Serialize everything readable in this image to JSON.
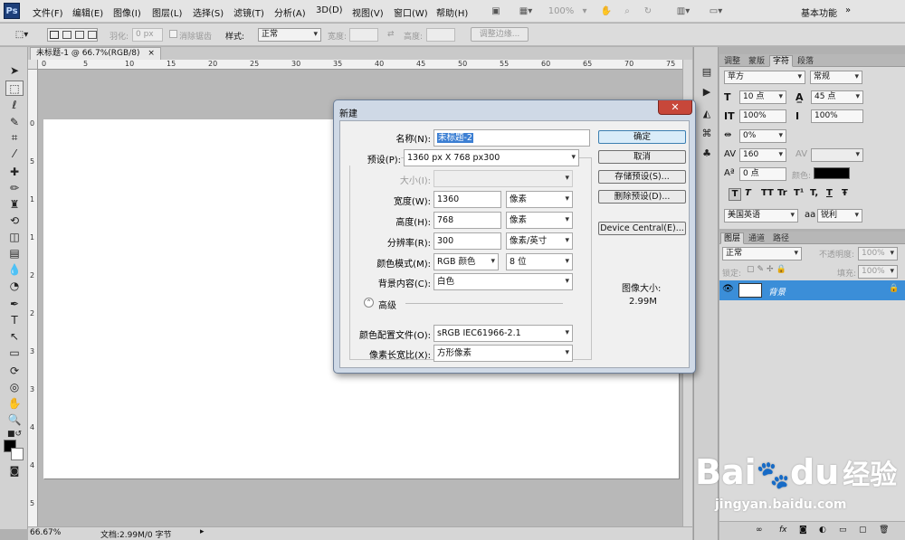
{
  "app": {
    "logo": "Ps"
  },
  "menu": [
    "文件(F)",
    "编辑(E)",
    "图像(I)",
    "图层(L)",
    "选择(S)",
    "滤镜(T)",
    "分析(A)",
    "3D(D)",
    "视图(V)",
    "窗口(W)",
    "帮助(H)"
  ],
  "topbar": {
    "zoom": "100%",
    "workspace": "基本功能"
  },
  "options": {
    "feather_label": "羽化:",
    "feather_value": "0 px",
    "antialias_label": "消除锯齿",
    "style_label": "样式:",
    "style_value": "正常",
    "width_label": "宽度:",
    "height_label": "高度:",
    "refine_button": "调整边缘..."
  },
  "document": {
    "tab_title": "未标题-1 @ 66.7%(RGB/8)",
    "status_zoom": "66.67%",
    "status_doc": "文档:2.99M/0 字节"
  },
  "ruler": {
    "h": [
      "0",
      "5",
      "10",
      "15",
      "20",
      "25",
      "30",
      "35",
      "40",
      "45",
      "50",
      "55",
      "60",
      "65",
      "70",
      "75"
    ],
    "v": [
      "0",
      "5",
      "1",
      "1",
      "2",
      "2",
      "3",
      "3",
      "4",
      "4",
      "5"
    ]
  },
  "dialog": {
    "title": "新建",
    "name_label": "名称(N):",
    "name_value": "未标题-2",
    "preset_label": "预设(P):",
    "preset_value": "1360 px X 768 px300",
    "size_label": "大小(I):",
    "width_label": "宽度(W):",
    "width_value": "1360",
    "width_unit": "像素",
    "height_label": "高度(H):",
    "height_value": "768",
    "height_unit": "像素",
    "resolution_label": "分辨率(R):",
    "resolution_value": "300",
    "resolution_unit": "像素/英寸",
    "colormode_label": "颜色模式(M):",
    "colormode_value": "RGB 颜色",
    "bitdepth_value": "8 位",
    "background_label": "背景内容(C):",
    "background_value": "白色",
    "advanced_label": "高级",
    "colorprofile_label": "颜色配置文件(O):",
    "colorprofile_value": "sRGB IEC61966-2.1",
    "pixelaspect_label": "像素长宽比(X):",
    "pixelaspect_value": "方形像素",
    "ok": "确定",
    "cancel": "取消",
    "save_preset": "存储预设(S)...",
    "delete_preset": "删除预设(D)...",
    "device_central": "Device Central(E)...",
    "image_size_label": "图像大小:",
    "image_size_value": "2.99M"
  },
  "char_panel": {
    "tabs": [
      "调整",
      "蒙版",
      "字符",
      "段落"
    ],
    "font_family": "苹方",
    "font_style": "常规",
    "font_size": "10 点",
    "leading": "45 点",
    "scale_v": "100%",
    "scale_h": "100%",
    "tracking_pct": "0%",
    "kerning": "160",
    "baseline": "0 点",
    "color_label": "颜色:",
    "type_styles": [
      "T",
      "T",
      "TT",
      "Tr",
      "T¹",
      "T,",
      "T",
      "Ŧ"
    ],
    "language": "美国英语",
    "aa_label": "aa",
    "antialias": "锐利"
  },
  "layers_panel": {
    "tabs": [
      "图层",
      "通道",
      "路径"
    ],
    "blend_mode": "正常",
    "opacity_label": "不透明度:",
    "opacity": "100%",
    "lock_label": "锁定:",
    "fill_label": "填充:",
    "fill": "100%",
    "layer_name": "背景"
  },
  "watermark": {
    "brand": "Bai",
    "brand_suffix": "du",
    "chinese": "经验",
    "url": "jingyan.baidu.com"
  }
}
